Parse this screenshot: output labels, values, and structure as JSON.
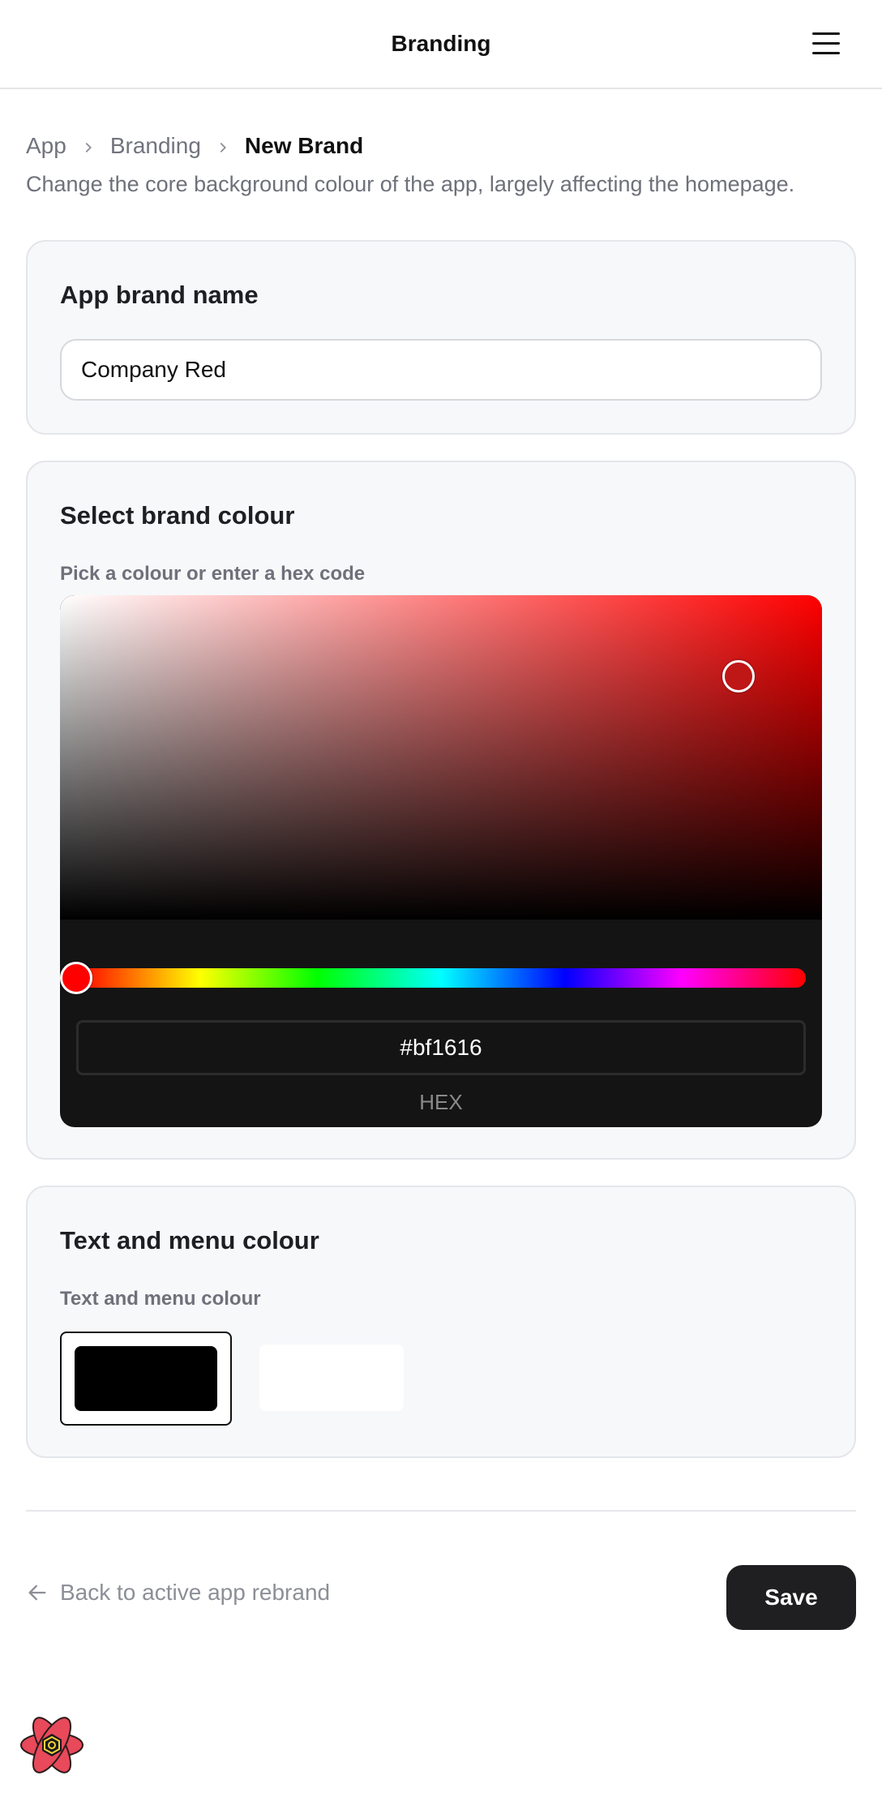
{
  "header": {
    "title": "Branding",
    "menu_icon": "hamburger-menu-icon"
  },
  "breadcrumb": {
    "items": [
      "App",
      "Branding",
      "New Brand"
    ],
    "separator_icon": "chevron-right-icon"
  },
  "page": {
    "description": "Change the core background colour of the app, largely affecting the homepage."
  },
  "brand_name_card": {
    "title": "App brand name",
    "input_value": "Company Red"
  },
  "brand_colour_card": {
    "title": "Select brand colour",
    "label": "Pick a colour or enter a hex code",
    "hex_value": "#bf1616",
    "hex_label": "HEX",
    "hue_degrees": 0,
    "saturation": 0.89,
    "brightness": 0.75,
    "picker_bg": "#141414"
  },
  "text_menu_card": {
    "title": "Text and menu colour",
    "label": "Text and menu colour",
    "options": [
      {
        "name": "black",
        "color": "#000000",
        "selected": true
      },
      {
        "name": "white",
        "color": "#ffffff",
        "selected": false
      }
    ]
  },
  "footer": {
    "back_label": "Back to active app rebrand",
    "back_icon": "arrow-left-icon",
    "save_label": "Save",
    "save_color": "#1f1f21"
  },
  "logo": {
    "icon": "atom-logo-icon"
  }
}
